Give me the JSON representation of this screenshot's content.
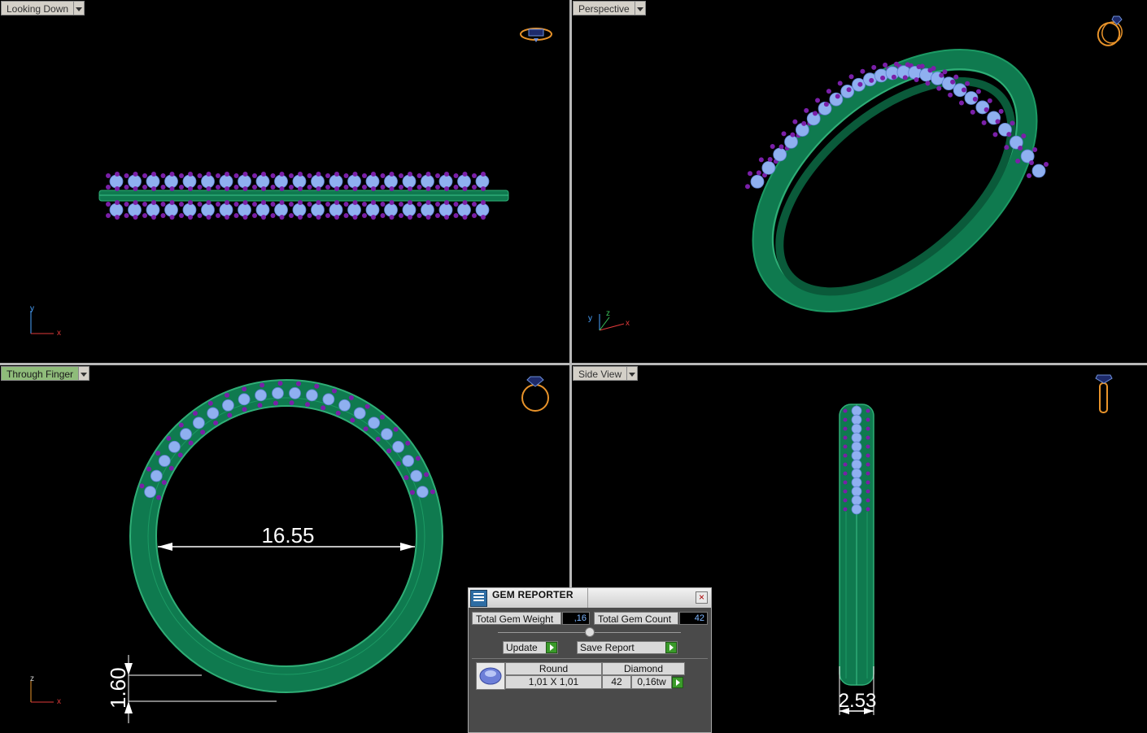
{
  "viewports": {
    "top_left": {
      "label": "Looking Down",
      "active": false,
      "axes": {
        "x": "x",
        "y": "y"
      }
    },
    "top_right": {
      "label": "Perspective",
      "active": false,
      "axes": {
        "x": "x",
        "y": "y",
        "z": "z"
      }
    },
    "bottom_left": {
      "label": "Through Finger",
      "active": true,
      "axes": {
        "x": "x",
        "y": "z"
      },
      "dimensions": {
        "inner_diameter": "16.55",
        "band_thickness": "1.60"
      }
    },
    "bottom_right": {
      "label": "Side View",
      "active": false,
      "dimensions": {
        "band_width": "2.53"
      }
    }
  },
  "gem_reporter": {
    "title": "GEM REPORTER",
    "total_weight_label": "Total Gem Weight",
    "total_weight_value": ",16",
    "total_count_label": "Total Gem Count",
    "total_count_value": "42",
    "update_label": "Update",
    "save_report_label": "Save Report",
    "table": {
      "headers": {
        "shape": "Round",
        "type": "Diamond"
      },
      "row": {
        "size": "1,01 X 1,01",
        "count": "42",
        "weight": "0,16tw"
      }
    }
  },
  "colors": {
    "band": "#13855a",
    "gem": "#8fb0f0",
    "prong": "#7a1fa8",
    "icon": "#e8932a",
    "viewport_bg": "#000000"
  }
}
